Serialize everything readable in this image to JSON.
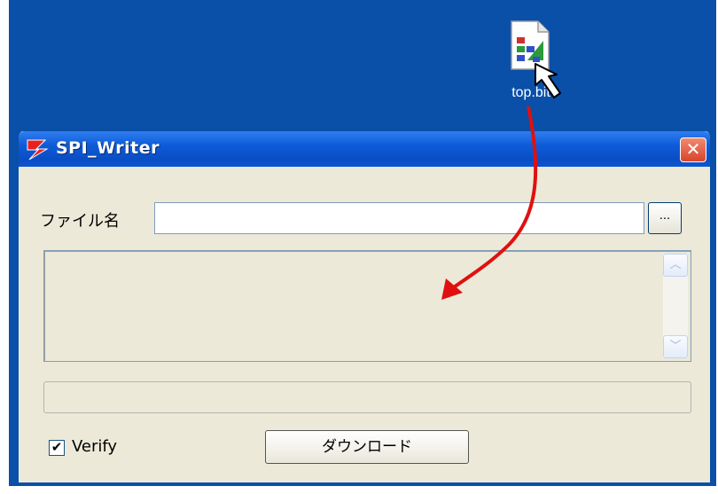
{
  "desktop": {
    "file_icon": {
      "label": "top.bit",
      "icon": "bit-file-icon"
    }
  },
  "window": {
    "title": "SPI_Writer",
    "close_label": "✕",
    "file_name_label": "ファイル名",
    "file_input_value": "",
    "browse_label": "...",
    "log_text": "",
    "verify_checked": true,
    "verify_label": "Verify",
    "download_label": "ダウンロード"
  },
  "annotation": {
    "arrow_color": "#e01010"
  },
  "colors": {
    "desktop_blue": "#0a4fa8",
    "titlebar_blue": "#0d5bd8",
    "window_bg": "#ece9d8",
    "close_red": "#d8442a"
  }
}
